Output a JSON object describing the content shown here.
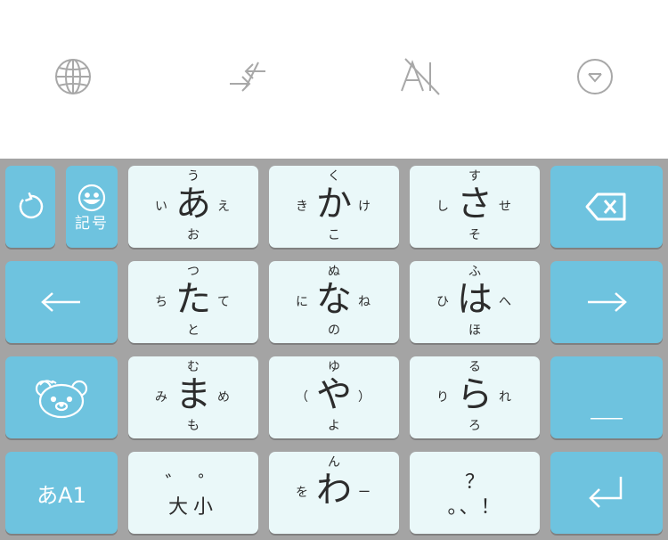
{
  "toolbar": {
    "icons": [
      "globe-icon",
      "swap-arrows-icon",
      "ai-off-icon",
      "collapse-keyboard-icon"
    ]
  },
  "keys": {
    "symbol_label": "記号",
    "mode_label": "あA1",
    "a": {
      "center": "あ",
      "top": "う",
      "bottom": "お",
      "left": "い",
      "right": "え"
    },
    "ka": {
      "center": "か",
      "top": "く",
      "bottom": "こ",
      "left": "き",
      "right": "け"
    },
    "sa": {
      "center": "さ",
      "top": "す",
      "bottom": "そ",
      "left": "し",
      "right": "せ"
    },
    "ta": {
      "center": "た",
      "top": "つ",
      "bottom": "と",
      "left": "ち",
      "right": "て"
    },
    "na": {
      "center": "な",
      "top": "ぬ",
      "bottom": "の",
      "left": "に",
      "right": "ね"
    },
    "ha": {
      "center": "は",
      "top": "ふ",
      "bottom": "ほ",
      "left": "ひ",
      "right": "へ"
    },
    "ma": {
      "center": "ま",
      "top": "む",
      "bottom": "も",
      "left": "み",
      "right": "め"
    },
    "ya": {
      "center": "や",
      "top": "ゆ",
      "bottom": "よ",
      "left": "（",
      "right": "）"
    },
    "ra": {
      "center": "ら",
      "top": "る",
      "bottom": "ろ",
      "left": "り",
      "right": "れ"
    },
    "wa": {
      "center": "わ",
      "top": "ん",
      "left": "を",
      "right": "ー"
    },
    "dakuten": {
      "marks": "゛ ゜",
      "label": "大小"
    },
    "punct": {
      "top": "？",
      "bottom": "。、！"
    },
    "space_label": "＿"
  },
  "colors": {
    "key_blue": "#6ec3df",
    "key_white": "#eaf8f9",
    "keyboard_bg": "#a4a4a4",
    "icon_gray": "#a8a8a8"
  }
}
